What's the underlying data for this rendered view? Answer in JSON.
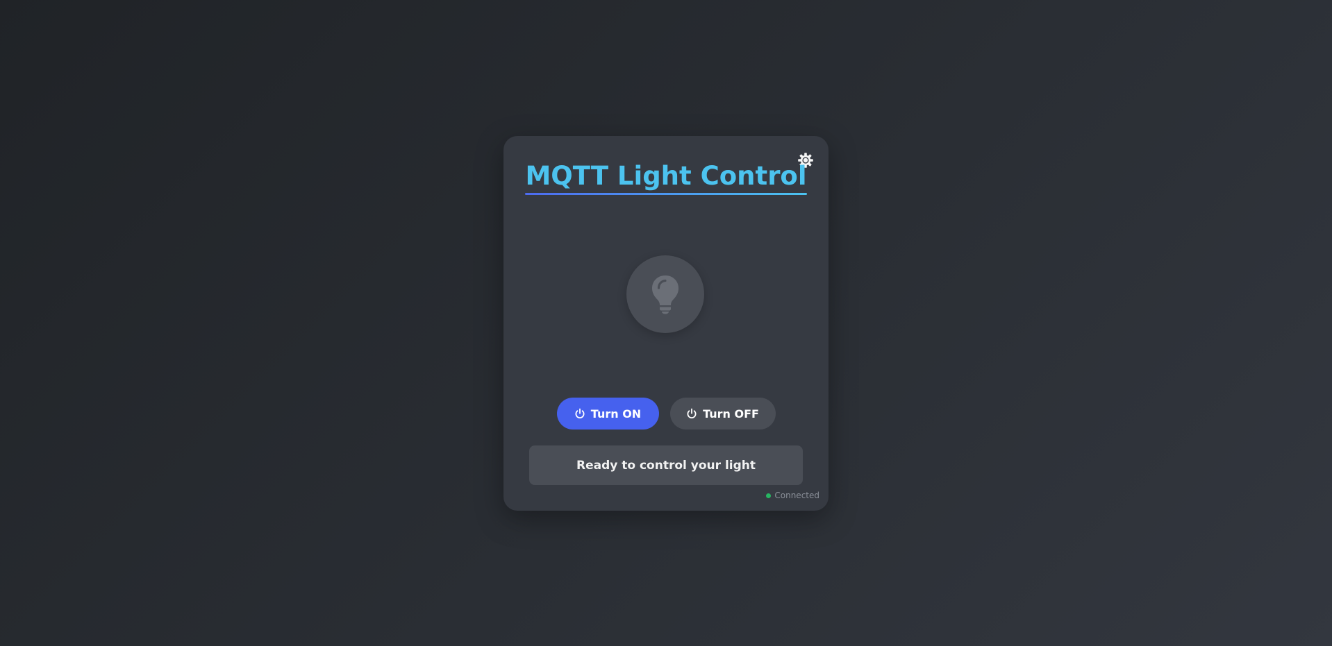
{
  "app": {
    "title": "MQTT Light Control"
  },
  "icons": {
    "theme_toggle": "gear-icon",
    "bulb": "lightbulb-icon",
    "power": "power-icon"
  },
  "controls": {
    "on_label": "Turn ON",
    "off_label": "Turn OFF"
  },
  "status": {
    "message": "Ready to control your light"
  },
  "connection": {
    "label": "Connected"
  },
  "colors": {
    "accent": "#4cc3ef",
    "primary_button": "#4661ee",
    "connected": "#27b562"
  }
}
